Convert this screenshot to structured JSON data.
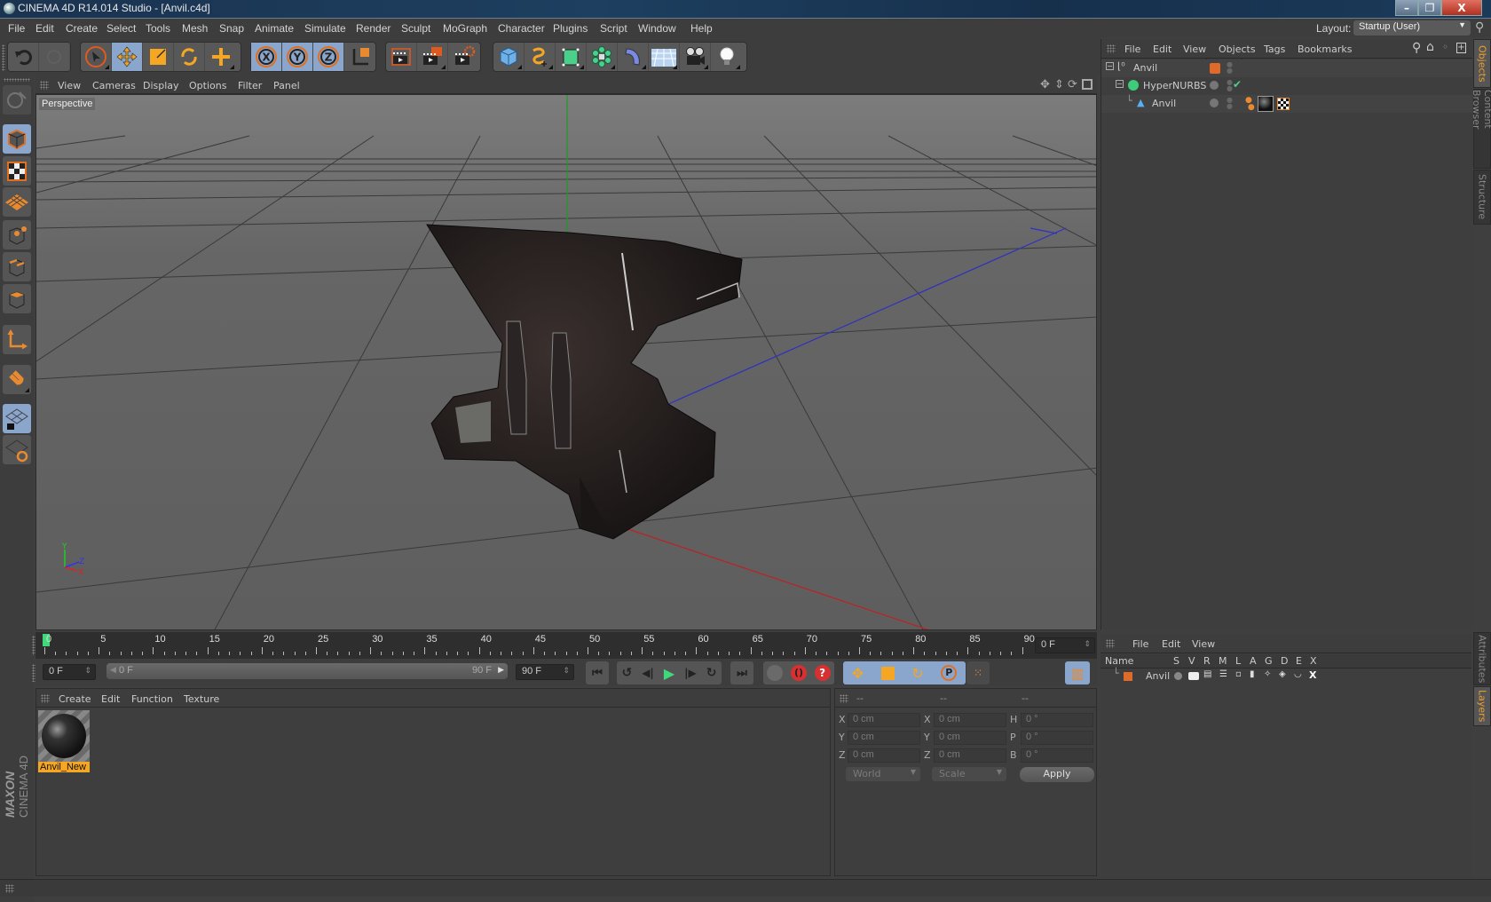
{
  "window": {
    "title": "CINEMA 4D R14.014 Studio - [Anvil.c4d]",
    "controls": {
      "minimize": "–",
      "restore": "❐",
      "close": "X"
    }
  },
  "menubar": {
    "items": [
      "File",
      "Edit",
      "Create",
      "Select",
      "Tools",
      "Mesh",
      "Snap",
      "Animate",
      "Simulate",
      "Render",
      "Sculpt",
      "MoGraph",
      "Character",
      "Plugins",
      "Script",
      "Window",
      "Help"
    ],
    "layout_label": "Layout:",
    "layout_value": "Startup (User)"
  },
  "toolbar": {
    "undo": "undo-icon",
    "redo": "redo-icon",
    "tools": [
      "live-selection",
      "move",
      "scale",
      "rotate",
      "recent-tool"
    ],
    "axis": [
      "X",
      "Y",
      "Z"
    ],
    "coord_system": "world-coordinates",
    "render": [
      "render-view",
      "render-to-picture-viewer",
      "render-settings"
    ],
    "create": [
      "cube",
      "spline",
      "nurbs",
      "array",
      "deformer",
      "floor",
      "camera",
      "light"
    ]
  },
  "viewport": {
    "menu": [
      "View",
      "Cameras",
      "Display",
      "Options",
      "Filter",
      "Panel"
    ],
    "camera_label": "Perspective",
    "axis_labels": {
      "y": "Y",
      "z": "Z",
      "x": "X"
    }
  },
  "object_manager": {
    "menu": [
      "File",
      "Edit",
      "View",
      "Objects",
      "Tags",
      "Bookmarks"
    ],
    "objects": [
      {
        "name": "Anvil",
        "type": "null",
        "level": 0,
        "layer_color": "#e06a28"
      },
      {
        "name": "HyperNURBS",
        "type": "hypernurbs",
        "level": 1,
        "enabled": "✔"
      },
      {
        "name": "Anvil",
        "type": "polygon",
        "level": 2
      }
    ]
  },
  "side_tabs_top": [
    {
      "label": "Objects",
      "active": true
    },
    {
      "label": "Content Browser",
      "active": false
    },
    {
      "label": "Structure",
      "active": false
    }
  ],
  "side_tabs_bottom": [
    {
      "label": "Attributes",
      "active": false
    },
    {
      "label": "Layers",
      "active": true
    }
  ],
  "timeline": {
    "ticks": [
      "0",
      "5",
      "10",
      "15",
      "20",
      "25",
      "30",
      "35",
      "40",
      "45",
      "50",
      "55",
      "60",
      "65",
      "70",
      "75",
      "80",
      "85",
      "90"
    ],
    "current_frame": "0 F",
    "start_field": "0 F",
    "range_start": "0 F",
    "range_end": "90 F",
    "end_field": "90 F"
  },
  "material_manager": {
    "menu": [
      "Create",
      "Edit",
      "Function",
      "Texture"
    ],
    "materials": [
      {
        "name": "Anvil_New",
        "selected": true
      }
    ]
  },
  "coordinates": {
    "headers": [
      "--",
      "--",
      "--"
    ],
    "rows": [
      {
        "l1": "X",
        "v1": "0 cm",
        "l2": "X",
        "v2": "0 cm",
        "l3": "H",
        "v3": "0 °"
      },
      {
        "l1": "Y",
        "v1": "0 cm",
        "l2": "Y",
        "v2": "0 cm",
        "l3": "P",
        "v3": "0 °"
      },
      {
        "l1": "Z",
        "v1": "0 cm",
        "l2": "Z",
        "v2": "0 cm",
        "l3": "B",
        "v3": "0 °"
      }
    ],
    "mode": "World",
    "transform": "Scale",
    "apply": "Apply"
  },
  "layer_manager": {
    "menu": [
      "File",
      "Edit",
      "View"
    ],
    "columns": [
      "Name",
      "S",
      "V",
      "R",
      "M",
      "L",
      "A",
      "G",
      "D",
      "E",
      "X"
    ],
    "layers": [
      {
        "name": "Anvil",
        "color": "#e06a28"
      }
    ]
  },
  "branding": {
    "line1": "MAXON",
    "line2": "CINEMA 4D"
  },
  "colors": {
    "accent": "#f0a030",
    "selected": "#8aa6cc",
    "orange": "#e06a28"
  }
}
